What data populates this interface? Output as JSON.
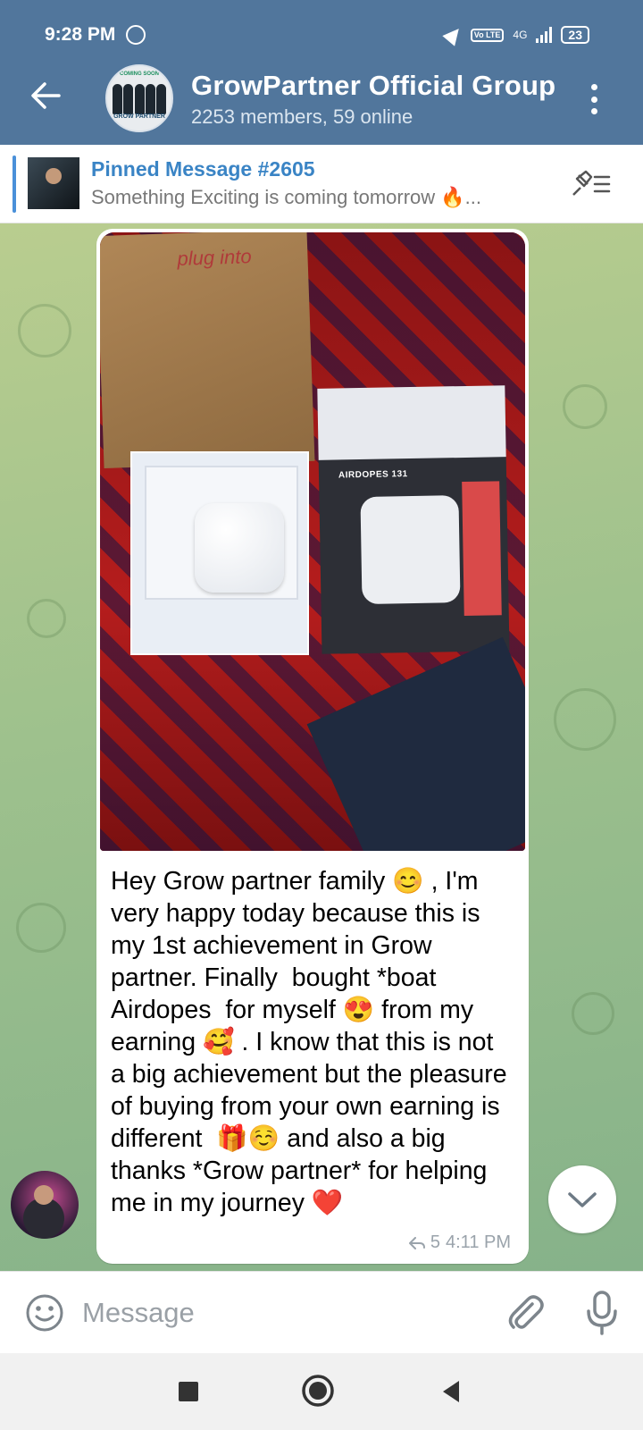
{
  "status_bar": {
    "time": "9:28 PM",
    "network": "4G",
    "volte": "Vo LTE",
    "battery": "23"
  },
  "header": {
    "title": "GrowPartner Official Group",
    "subtitle": "2253 members, 59 online",
    "avatar_top_text": "COMING SOON",
    "avatar_text": "GROW PARTNER"
  },
  "pinned": {
    "title": "Pinned Message #2605",
    "text": "Something Exciting is coming tomorrow 🔥..."
  },
  "message": {
    "image_box_label": "AIRDOPES 131",
    "image_box_brand": "plug into",
    "text": "Hey Grow partner family 😊 , I'm very happy today because this is my 1st achievement in Grow partner. Finally  bought *boat Airdopes  for myself 😍 from my earning 🥰 . I know that this is not a big achievement but the pleasure of buying from your own earning is different  🎁☺️ and also a big thanks *Grow partner* for helping me in my journey ❤️",
    "replies": "5",
    "time": "4:11 PM"
  },
  "input": {
    "placeholder": "Message"
  },
  "colors": {
    "header": "#51769c",
    "accent": "#3a84c5",
    "chat_bg": "#9ec18d"
  }
}
